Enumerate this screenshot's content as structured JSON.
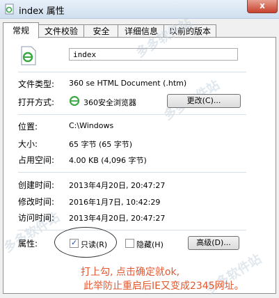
{
  "window": {
    "title": "index 属性",
    "close_glyph": "x"
  },
  "tabs": [
    {
      "label": "常规",
      "active": true
    },
    {
      "label": "文件校验"
    },
    {
      "label": "安全"
    },
    {
      "label": "详细信息"
    },
    {
      "label": "以前的版本"
    }
  ],
  "file": {
    "name": "index"
  },
  "info": {
    "type_label": "文件类型:",
    "type_value": "360 se HTML Document (.htm)",
    "open_label": "打开方式:",
    "open_value": "360安全浏览器",
    "change_button": "更改(C)...",
    "location_label": "位置:",
    "location_value": "C:\\Windows",
    "size_label": "大小:",
    "size_value": "65 字节 (65 字节)",
    "disk_label": "占用空间:",
    "disk_value": "4.00 KB (4,096 字节)",
    "created_label": "创建时间:",
    "created_value": "2013年4月20日, 20:47:27",
    "modified_label": "修改时间:",
    "modified_value": "2016年1月7日, 10:42:29",
    "accessed_label": "访问时间:",
    "accessed_value": "2013年4月20日, 20:47:27",
    "attr_label": "属性:",
    "readonly_label": "只读(R)",
    "readonly_checked": true,
    "hidden_label": "隐藏(H)",
    "hidden_checked": false,
    "advanced_button": "高级(D)..."
  },
  "annotation": {
    "line1": "打上勾, 点击确定就ok,",
    "line2": "此举防止重启后IE又变成2345网址。",
    "color": "#e4572e"
  },
  "watermark": {
    "text": "多多软件站"
  }
}
